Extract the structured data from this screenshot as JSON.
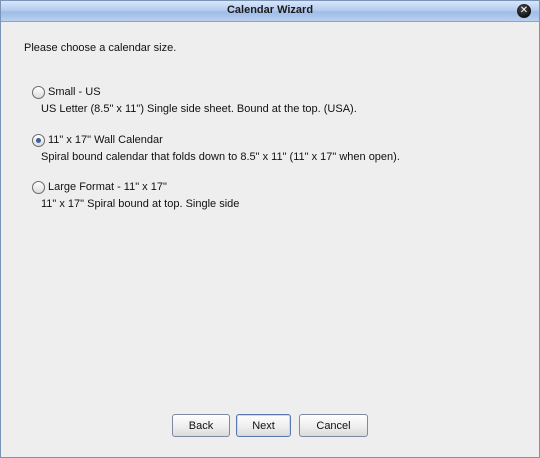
{
  "window": {
    "title": "Calendar Wizard",
    "close_glyph": "✕"
  },
  "prompt": "Please choose a calendar size.",
  "options": [
    {
      "label": "Small - US",
      "description": "US Letter (8.5\" x 11\") Single side sheet. Bound at the top. (USA).",
      "checked": false
    },
    {
      "label": "11\" x 17\" Wall Calendar",
      "description": "Spiral bound calendar that folds down to 8.5\" x 11\" (11\" x 17\" when open).",
      "checked": true
    },
    {
      "label": "Large Format - 11\" x 17\"",
      "description": "11\" x 17\" Spiral bound at top. Single side",
      "checked": false
    }
  ],
  "buttons": {
    "back": "Back",
    "next": "Next",
    "cancel": "Cancel"
  }
}
